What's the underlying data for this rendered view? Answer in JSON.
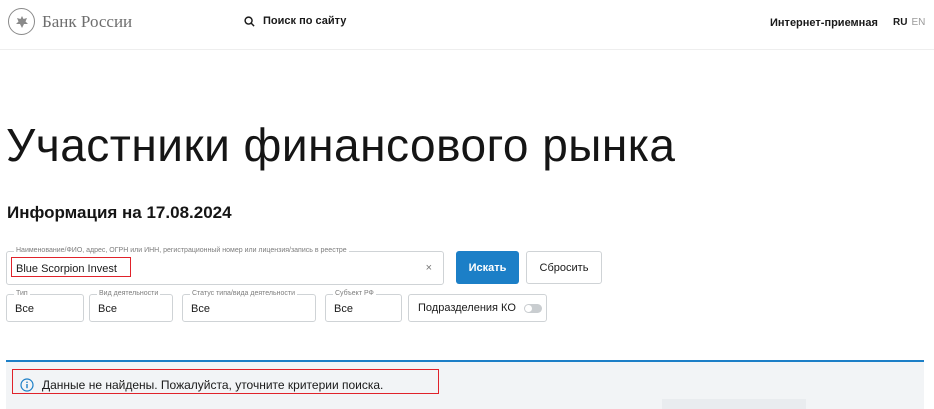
{
  "header": {
    "logo_text": "Банк России",
    "search_label": "Поиск по сайту",
    "reception_label": "Интернет-приемная",
    "lang_ru": "RU",
    "lang_en": "EN"
  },
  "main": {
    "title": "Участники финансового рынка",
    "info_date": "Информация на 17.08.2024"
  },
  "search": {
    "legend": "Наименование/ФИО, адрес, ОГРН или ИНН, регистрационный номер или лицензия/запись в реестре",
    "value": "Blue Scorpion Invest",
    "clear_icon": "×",
    "search_button": "Искать",
    "reset_button": "Сбросить"
  },
  "filters": {
    "type": {
      "legend": "Тип",
      "value": "Все"
    },
    "activity": {
      "legend": "Вид деятельности",
      "value": "Все"
    },
    "status": {
      "legend": "Статус типа/вида деятельности",
      "value": "Все"
    },
    "subject": {
      "legend": "Субъект РФ",
      "value": "Все"
    },
    "ko_toggle": {
      "label": "Подразделения КО",
      "on": false
    }
  },
  "result": {
    "message": "Данные не найдены. Пожалуйста, уточните критерии поиска.",
    "info_icon": "info-icon"
  },
  "colors": {
    "accent": "#1c7fc7",
    "highlight": "#e0222a"
  }
}
